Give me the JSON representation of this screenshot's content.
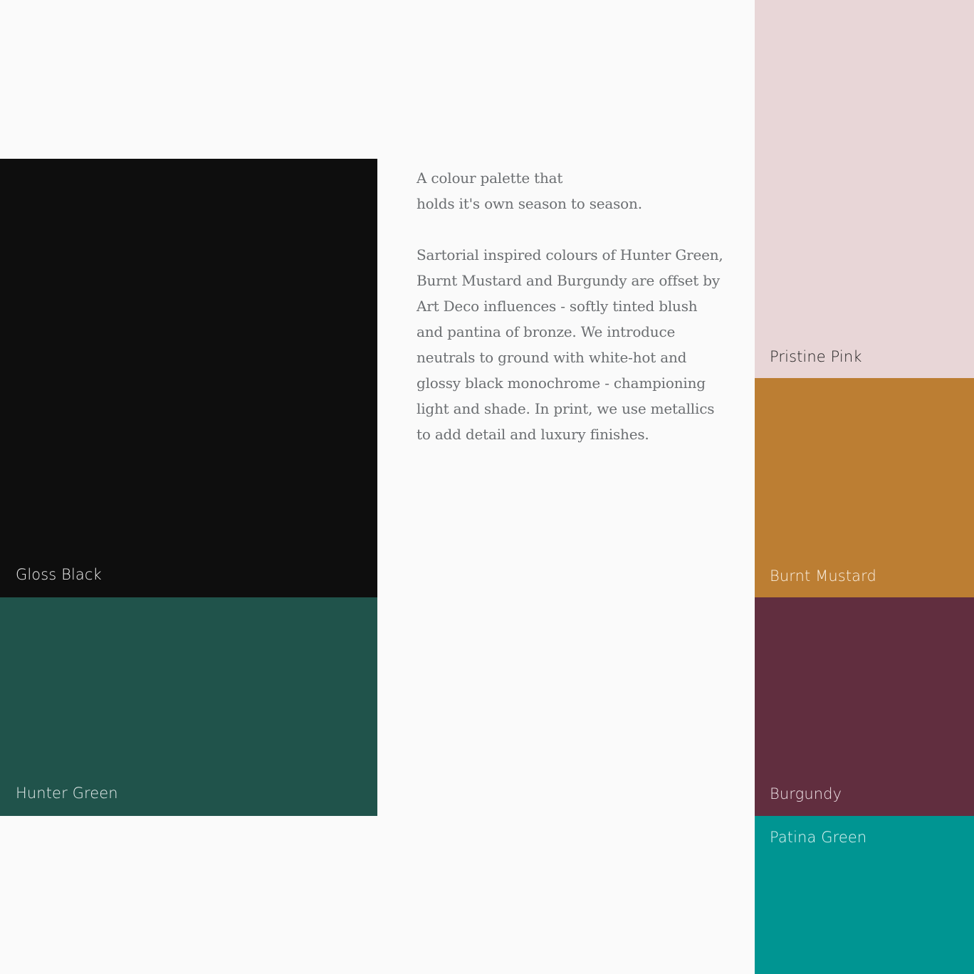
{
  "intro": "A colour palette that\nholds it's own season to season.",
  "body": "Sartorial inspired colours of Hunter Green,\nBurnt Mustard and Burgundy are offset by\nArt Deco influences - softly tinted blush\nand pantina of bronze. We introduce\nneutrals to ground with white-hot and\nglossy black monochrome - championing\nlight and shade. In print, we use metallics\nto add detail and luxury finishes.",
  "swatches": {
    "gloss_black": {
      "name": "Gloss Black",
      "color": "#0e0e0e"
    },
    "hunter_green": {
      "name": "Hunter Green",
      "color": "#20534b"
    },
    "pristine_pink": {
      "name": "Pristine Pink",
      "color": "#e8d6d7"
    },
    "burnt_mustard": {
      "name": "Burnt Mustard",
      "color": "#bc7e33"
    },
    "burgundy": {
      "name": "Burgundy",
      "color": "#612e3f"
    },
    "patina_green": {
      "name": "Patina Green",
      "color": "#009592"
    }
  },
  "background_color": "#fafafa"
}
